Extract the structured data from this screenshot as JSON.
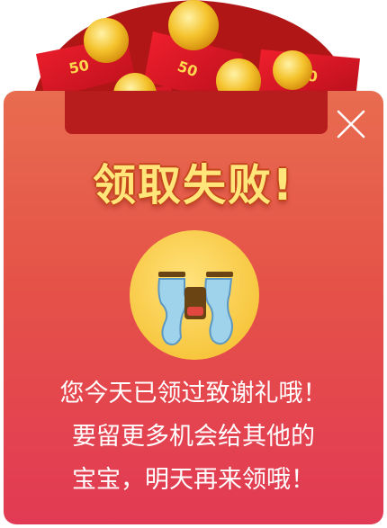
{
  "dialog": {
    "title": "领取失败!",
    "message_lines": [
      "您今天已领过致谢礼哦！",
      "要留更多机会给其他的",
      "宝宝，明天再来领哦！"
    ]
  },
  "icons": {
    "close": "close-icon",
    "emoji": "crying-face-icon",
    "decoration": "coins-and-red-packets"
  },
  "colors": {
    "panel_top": "#e86c4f",
    "panel_bottom": "#e23a54",
    "title": "#ffe57a",
    "text": "#ffffff",
    "emoji_face": "#ffd75a"
  }
}
